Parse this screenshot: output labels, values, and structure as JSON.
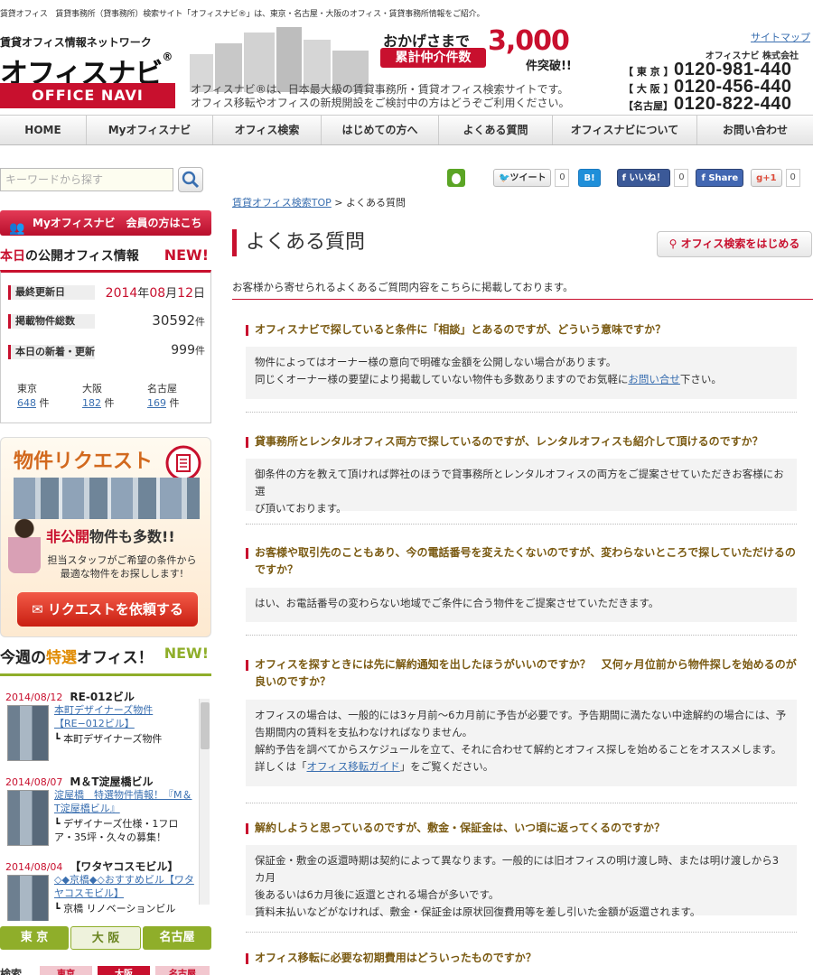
{
  "header": {
    "topline": "賃貸オフィス　賃貸事務所（貸事務所）検索サイト「オフィスナビ®」は、東京・名古屋・大阪のオフィス・賃貸事務所情報をご紹介。",
    "sitemap": "サイトマップ",
    "logo_tagline": "賃貸オフィス情報ネットワーク",
    "logo_main": "オフィスナビ",
    "logo_reg": "®",
    "logo_en": "OFFICE NAVI",
    "promo_lead": "おかげさまで",
    "promo_count": "3,000",
    "promo_label": "累計仲介件数",
    "promo_tail": "件突破!!",
    "desc_line1": "オフィスナビ®は、日本最大級の賃貸事務所・賃貸オフィス検索サイトです。",
    "desc_line2": "オフィス移転やオフィスの新規開設をご検討中の方はどうぞご利用ください。",
    "company": "オフィスナビ 株式会社",
    "phones": [
      {
        "city": "【 東 京 】",
        "number": "0120-981-440"
      },
      {
        "city": "【 大 阪 】",
        "number": "0120-456-440"
      },
      {
        "city": "【名古屋】",
        "number": "0120-822-440"
      }
    ]
  },
  "nav": [
    "HOME",
    "Myオフィスナビ",
    "オフィス検索",
    "はじめての方へ",
    "よくある質問",
    "オフィスナビについて",
    "お問い合わせ"
  ],
  "sidebar": {
    "search_placeholder": "キーワードから探す",
    "my_banner": "Myオフィスナビ　会員の方はこちら",
    "today_title_red": "本日",
    "today_title_rest": "の公開オフィス情報",
    "today_new": "NEW!",
    "updated_label": "最終更新日",
    "updated_year": "2014",
    "updated_y": "年",
    "updated_month": "08",
    "updated_m": "月",
    "updated_day": "12",
    "updated_d": "日",
    "total_label": "掲載物件総数",
    "total_value": "30592",
    "total_unit": "件",
    "new_label": "本日の新着・更新",
    "new_value": "999",
    "new_unit": "件",
    "cities": [
      {
        "name": "東京",
        "count": "648",
        "unit": "件"
      },
      {
        "name": "大阪",
        "count": "182",
        "unit": "件"
      },
      {
        "name": "名古屋",
        "count": "169",
        "unit": "件"
      }
    ],
    "request_title": "物件リクエスト",
    "request_hidden_a": "非公開",
    "request_hidden_b": "物件も多数!!",
    "request_text1": "担当スタッフがご希望の条件から",
    "request_text2": "最適な物件をお探しします!",
    "request_button": "リクエストを依頼する",
    "week_title_a": "今週の",
    "week_title_b": "特選",
    "week_title_c": "オフィス！",
    "week_new": "NEW!",
    "week_items": [
      {
        "date": "2014/08/12",
        "name": "RE-012ビル",
        "link": "本町デザイナーズ物件【RE−012ビル】",
        "sub": "┗ 本町デザイナーズ物件"
      },
      {
        "date": "2014/08/07",
        "name": "M＆T淀屋橋ビル",
        "link": "淀屋橋　特選物件情報！『M＆T淀屋橋ビル』",
        "sub": "┗ デザイナーズ仕様・1フロア・35坪・久々の募集！"
      },
      {
        "date": "2014/08/04",
        "name": "【ワタヤコスモビル】",
        "link": "◇◆京橋◆◇おすすめビル【ワタヤコスモビル】",
        "sub": "┗ 京橋 リノベーションビル"
      }
    ],
    "region_tabs": [
      "東 京",
      "大 阪",
      "名古屋"
    ],
    "bottom_label": "検索",
    "bottom_tabs": [
      "東京",
      "大阪",
      "名古屋"
    ]
  },
  "social": {
    "tweet": "ツイート",
    "tweet_count": "0",
    "hatena": "B!",
    "hatena_count": "0",
    "like": "いいね！",
    "like_count": "0",
    "share": "Share",
    "gplus": "g+1",
    "gplus_count": "0"
  },
  "main": {
    "breadcrumb_link": "賃貸オフィス検索TOP",
    "breadcrumb_sep": " > ",
    "breadcrumb_current": "よくある質問",
    "title": "よくある質問",
    "start_button": "オフィス検索をはじめる",
    "intro": "お客様から寄せられるよくあるご質問内容をこちらに掲載しております。",
    "faqs": [
      {
        "q": "オフィスナビで探していると条件に「相談」とあるのですが、どういう意味ですか？",
        "a": [
          "物件によってはオーナー様の意向で明確な金額を公開しない場合があります。",
          "同じくオーナー様の要望により掲載していない物件も多数ありますのでお気軽に"
        ],
        "a_link": "お問い合せ",
        "a_tail": "下さい。"
      },
      {
        "q": "貸事務所とレンタルオフィス両方で探しているのですが、レンタルオフィスも紹介して頂けるのですか？",
        "a": [
          "御条件の方を教えて頂ければ弊社のほうで貸事務所とレンタルオフィスの両方をご提案させていただきお客様にお選",
          "び頂いております。"
        ]
      },
      {
        "q": "お客様や取引先のこともあり、今の電話番号を変えたくないのですが、変わらないところで探していただけるのですか？",
        "a": [
          "はい、お電話番号の変わらない地域でご条件に合う物件をご提案させていただきます。"
        ]
      },
      {
        "q": "オフィスを探すときには先に解約通知を出したほうがいいのですか？　又何ヶ月位前から物件探しを始めるのが良いのですか？",
        "a": [
          "オフィスの場合は、一般的には3ヶ月前〜6カ月前に予告が必要です。予告期間に満たない中途解約の場合には、予",
          "告期間内の賃料を支払わなければなりません。",
          "解約予告を調べてからスケジュールを立て、それに合わせて解約とオフィス探しを始めることをオススメします。",
          "詳しくは「"
        ],
        "a_link": "オフィス移転ガイド",
        "a_tail": "」をご覧ください。"
      },
      {
        "q": "解約しようと思っているのですが、敷金・保証金は、いつ頃に返ってくるのですか？",
        "a": [
          "保証金・敷金の返還時期は契約によって異なります。一般的には旧オフィスの明け渡し時、または明け渡しから3カ月",
          "後あるいは6カ月後に返還とされる場合が多いです。",
          "賃料未払いなどがなければ、敷金・保証金は原状回復費用等を差し引いた金額が返還されます。"
        ]
      },
      {
        "q": "オフィス移転に必要な初期費用はどういったものですか？"
      }
    ]
  }
}
